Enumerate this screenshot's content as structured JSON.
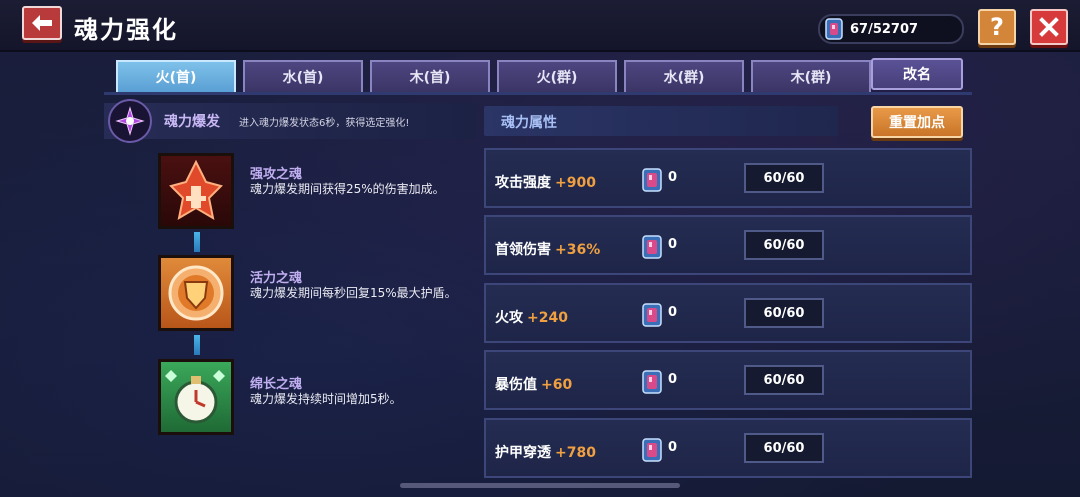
{
  "header": {
    "title": "魂力强化",
    "currency": "67/52707",
    "help_label": "?"
  },
  "tabs": [
    {
      "label": "火(首)",
      "active": true
    },
    {
      "label": "水(首)",
      "active": false
    },
    {
      "label": "木(首)",
      "active": false
    },
    {
      "label": "火(群)",
      "active": false
    },
    {
      "label": "水(群)",
      "active": false
    },
    {
      "label": "木(群)",
      "active": false
    }
  ],
  "rename_label": "改名",
  "burst": {
    "title": "魂力爆发",
    "desc": "进入魂力爆发状态6秒，获得选定强化!"
  },
  "souls": [
    {
      "name": "强攻之魂",
      "desc": "魂力爆发期间获得25%的伤害加成。",
      "color": "#c0392b"
    },
    {
      "name": "活力之魂",
      "desc": "魂力爆发期间每秒回复15%最大护盾。",
      "color": "#e08a3a"
    },
    {
      "name": "绵长之魂",
      "desc": "魂力爆发持续时间增加5秒。",
      "color": "#3aa85a"
    }
  ],
  "attributes_title": "魂力属性",
  "reset_label": "重置加点",
  "attributes": [
    {
      "name": "攻击强度",
      "bonus": "+900",
      "count": "0",
      "progress": "60/60"
    },
    {
      "name": "首领伤害",
      "bonus": "+36%",
      "count": "0",
      "progress": "60/60"
    },
    {
      "name": "火攻",
      "bonus": "+240",
      "count": "0",
      "progress": "60/60"
    },
    {
      "name": "暴伤值",
      "bonus": "+60",
      "count": "0",
      "progress": "60/60"
    },
    {
      "name": "护甲穿透",
      "bonus": "+780",
      "count": "0",
      "progress": "60/60"
    }
  ],
  "colors": {
    "accent_orange": "#f0a040",
    "active_tab": "#7ec1ea",
    "close_red": "#d63a3a",
    "help_orange": "#d3853a"
  }
}
